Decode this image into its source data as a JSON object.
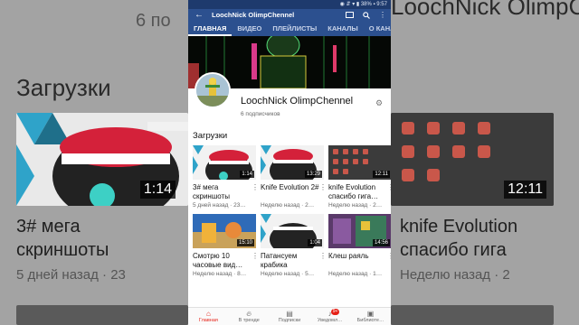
{
  "status_bar": {
    "left": "",
    "right": "◉ ⇵ ▾ ▮ 38% ▪ 9:57"
  },
  "app_bar": {
    "back": "←",
    "title": "LoochNick OlimpChennel",
    "icons": [
      "cast-icon",
      "search-icon",
      "more-icon"
    ]
  },
  "tabs": [
    "ГЛАВНАЯ",
    "ВИДЕО",
    "ПЛЕЙЛИСТЫ",
    "КАНАЛЫ",
    "О КАНАЛЕ"
  ],
  "channel": {
    "name": "LoochNick OlimpChennel",
    "subscribers": "6 подписчиков"
  },
  "section_title": "Загрузки",
  "videos": [
    {
      "title": "3# мега скриншоты",
      "meta": "5 дней назад · 23…",
      "duration": "1:14"
    },
    {
      "title": "Knife Evolution 2#",
      "meta": "Неделю назад · 2…",
      "duration": "13:29"
    },
    {
      "title": "knife Evolution спасибо гига…",
      "meta": "Неделю назад · 2…",
      "duration": "12:11"
    },
    {
      "title": "Смотрю 10 часовые вид…",
      "meta": "Неделю назад · 8…",
      "duration": "15:10"
    },
    {
      "title": "Патансуем крабика",
      "meta": "Неделю назад · 5…",
      "duration": "1:04"
    },
    {
      "title": "Клеш раяль",
      "meta": "Неделю назад · 1…",
      "duration": "14:56"
    }
  ],
  "bottom_nav": [
    {
      "label": "Главная",
      "icon": "home-icon",
      "active": true
    },
    {
      "label": "В тренде",
      "icon": "trending-icon",
      "active": false
    },
    {
      "label": "Подписки",
      "icon": "subscriptions-icon",
      "active": false
    },
    {
      "label": "Уведомл…",
      "icon": "bell-icon",
      "active": false,
      "badge": "9+"
    },
    {
      "label": "Библиоте…",
      "icon": "library-icon",
      "active": false
    }
  ],
  "background": {
    "top_text": "6 по",
    "section_title": "Загрузки",
    "left_title_1": "3# мега",
    "left_title_2": "скриншоты",
    "left_meta": "5 дней назад · 23",
    "left_duration": "1:14",
    "right_title_1": "knife Evolution",
    "right_title_2": "спасибо гига",
    "right_meta": "Неделю назад · 2",
    "right_duration": "12:11",
    "right_top": "LoochNick OlimpChennel"
  },
  "colors": {
    "appbar": "#2c508f",
    "statusbar": "#1e3a6d",
    "accent": "#e62117"
  }
}
